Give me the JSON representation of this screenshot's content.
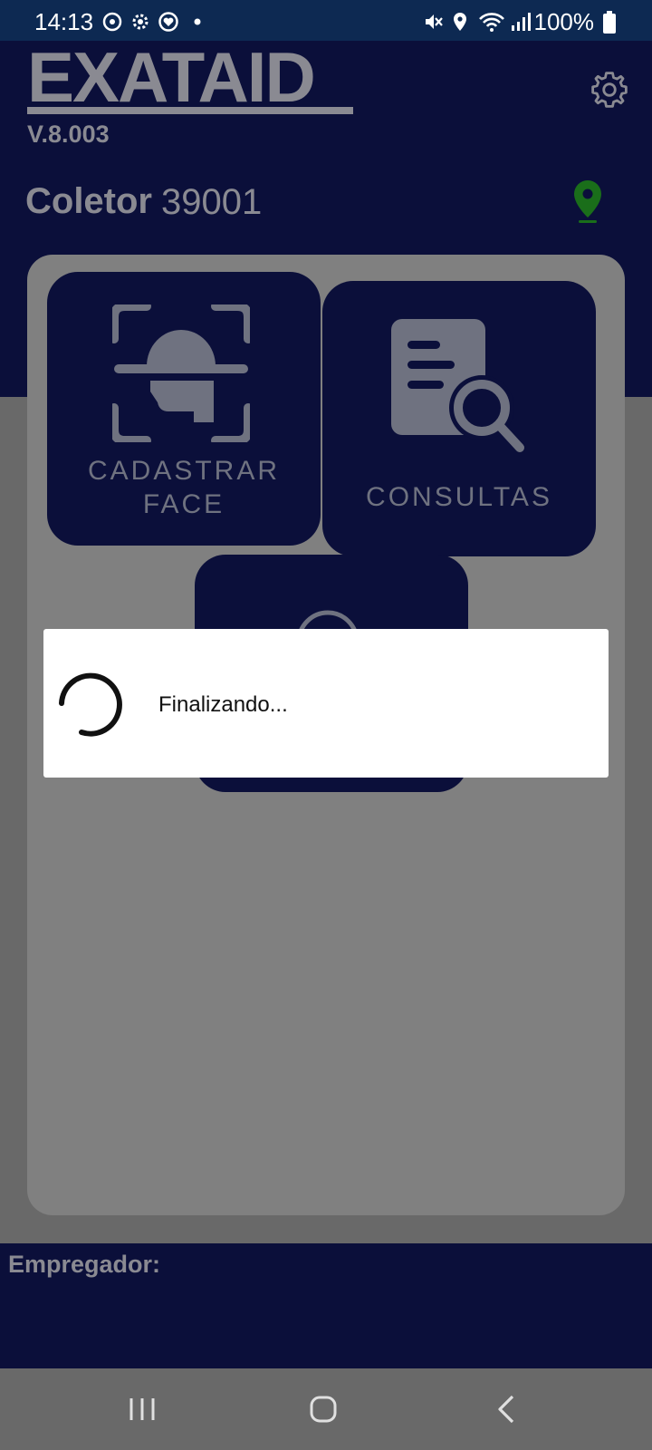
{
  "status_bar": {
    "time": "14:13",
    "battery": "100%",
    "icons": [
      "sync-icon",
      "gear-icon",
      "heart-icon",
      "dot-icon",
      "mute-icon",
      "location-icon",
      "wifi-icon",
      "signal-icon",
      "battery-icon"
    ]
  },
  "header": {
    "logo_text": "EXATAID",
    "version": "V.8.003",
    "coletor_label": "Coletor",
    "coletor_value": "39001",
    "location_color": "#1a6e1a"
  },
  "tiles": {
    "cadastrar_line1": "CADASTRAR",
    "cadastrar_line2": "FACE",
    "consultas": "CONSULTAS"
  },
  "dialog": {
    "message": "Finalizando..."
  },
  "footer": {
    "empregador_label": "Empregador:"
  },
  "colors": {
    "navy": "#0b0f3a",
    "overlay_gray": "#696969",
    "status_bar": "#0d2952"
  }
}
